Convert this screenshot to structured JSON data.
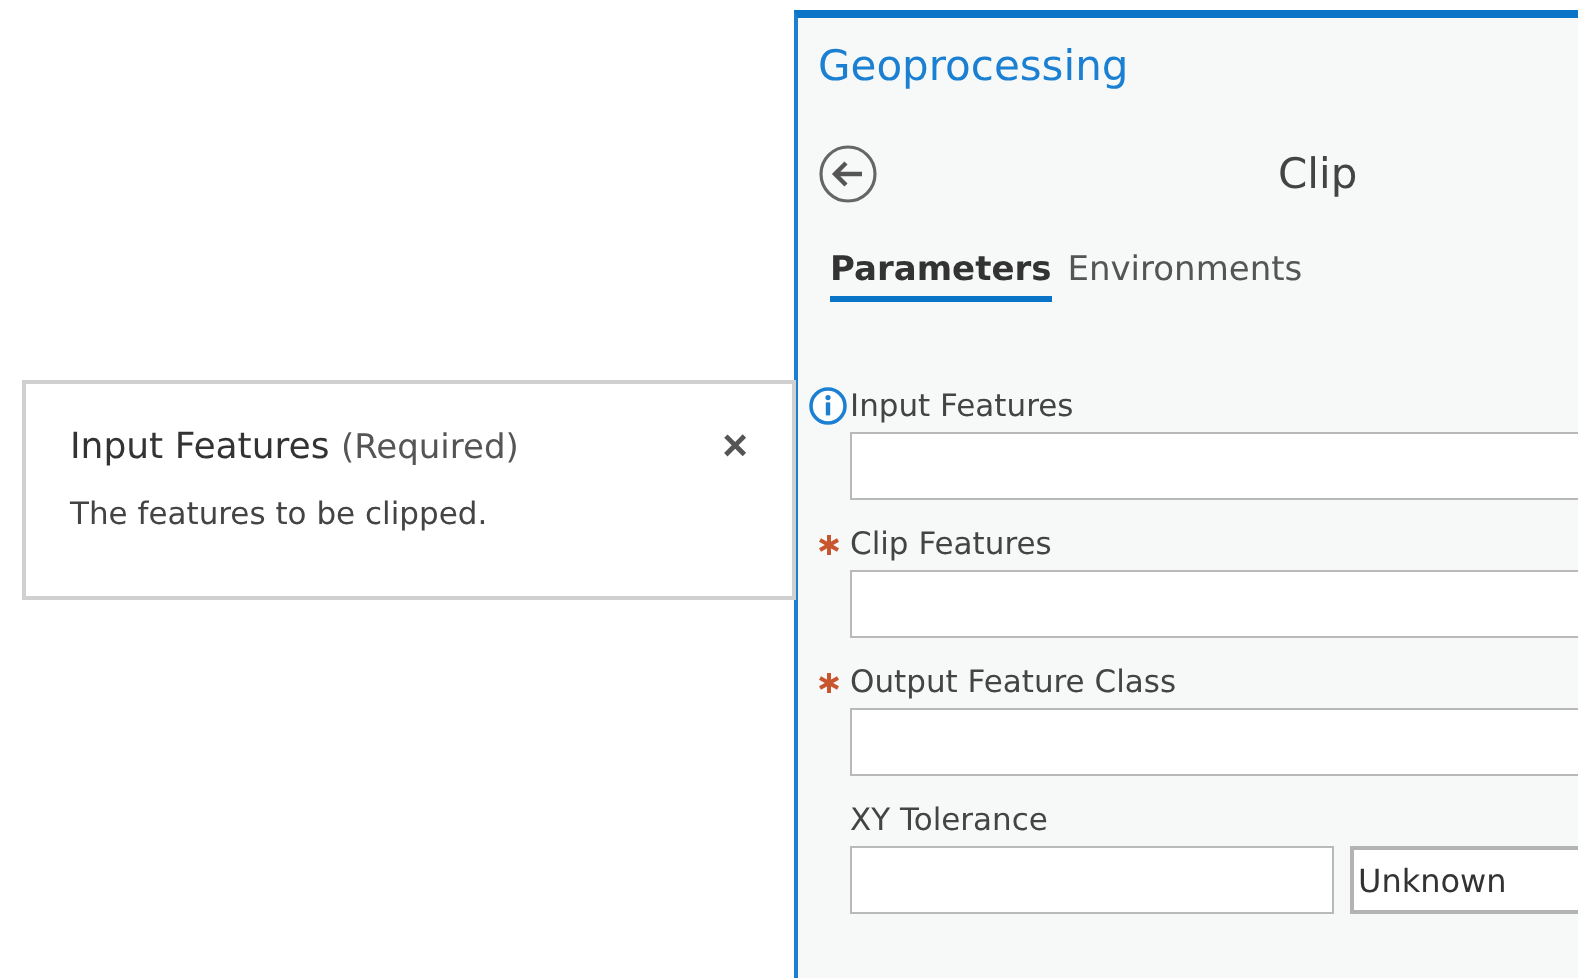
{
  "popup": {
    "title": "Input Features",
    "qualifier": "(Required)",
    "close": "×",
    "description": "The features to be clipped."
  },
  "panel": {
    "title": "Geoprocessing",
    "tool": "Clip",
    "tabs": [
      {
        "label": "Parameters",
        "selected": true
      },
      {
        "label": "Environments",
        "selected": false
      }
    ],
    "parameters": [
      {
        "label": "Input Features",
        "info": true,
        "required": false,
        "kind": "text"
      },
      {
        "label": "Clip Features",
        "info": false,
        "required": true,
        "kind": "text"
      },
      {
        "label": "Output Feature Class",
        "info": false,
        "required": true,
        "kind": "text"
      },
      {
        "label": "XY Tolerance",
        "info": false,
        "required": false,
        "kind": "linear_unit",
        "unit": "Unknown"
      }
    ]
  }
}
